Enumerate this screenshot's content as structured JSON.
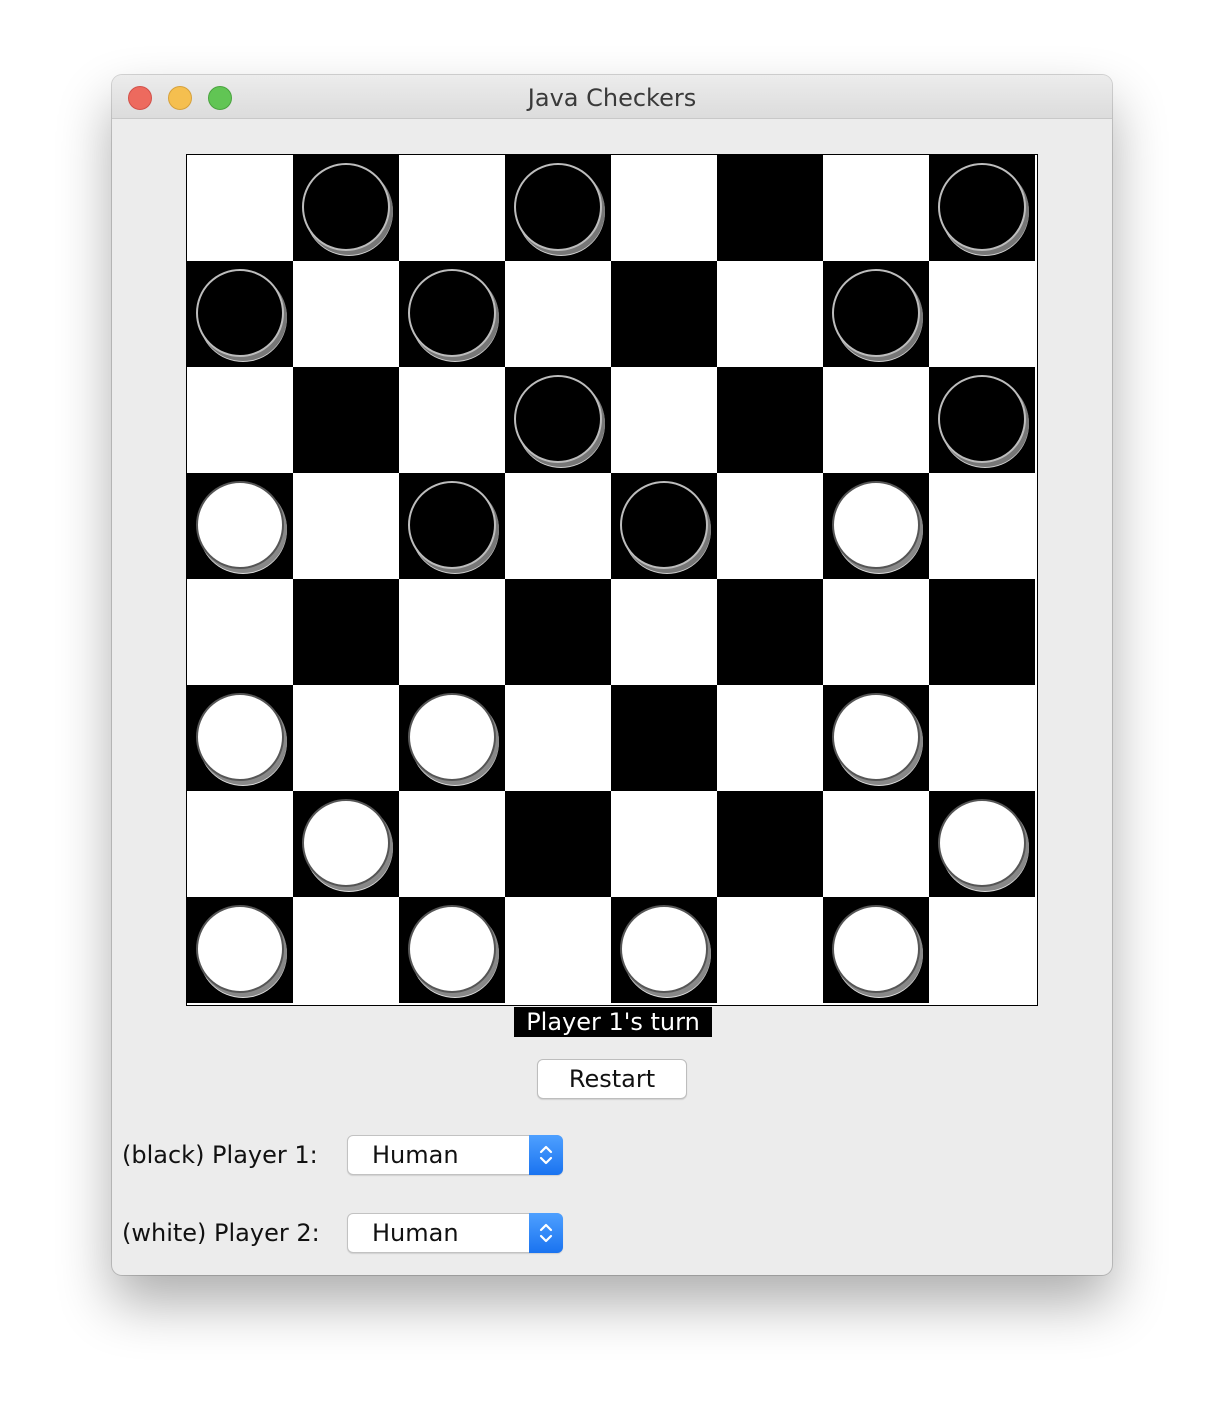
{
  "window": {
    "title": "Java Checkers"
  },
  "board": {
    "rows": [
      [
        "",
        "black",
        "",
        "black",
        "",
        "",
        "",
        "black"
      ],
      [
        "black",
        "",
        "black",
        "",
        "",
        "",
        "black",
        ""
      ],
      [
        "",
        "",
        "",
        "black",
        "",
        "",
        "",
        "black"
      ],
      [
        "white",
        "",
        "black",
        "",
        "black",
        "",
        "white",
        ""
      ],
      [
        "",
        "",
        "",
        "",
        "",
        "",
        "",
        ""
      ],
      [
        "white",
        "",
        "white",
        "",
        "",
        "",
        "white",
        ""
      ],
      [
        "",
        "white",
        "",
        "",
        "",
        "",
        "",
        "white"
      ],
      [
        "white",
        "",
        "white",
        "",
        "white",
        "",
        "white",
        ""
      ]
    ]
  },
  "status": {
    "text": "Player 1's turn"
  },
  "controls": {
    "restart_label": "Restart",
    "player1_label": "(black) Player 1:",
    "player1_value": "Human",
    "player2_label": "(white) Player 2:",
    "player2_value": "Human"
  },
  "colors": {
    "close": "#ed6a5e",
    "minimize": "#f5bf4f",
    "maximize": "#61c554",
    "select_accent": "#1a73f0"
  }
}
